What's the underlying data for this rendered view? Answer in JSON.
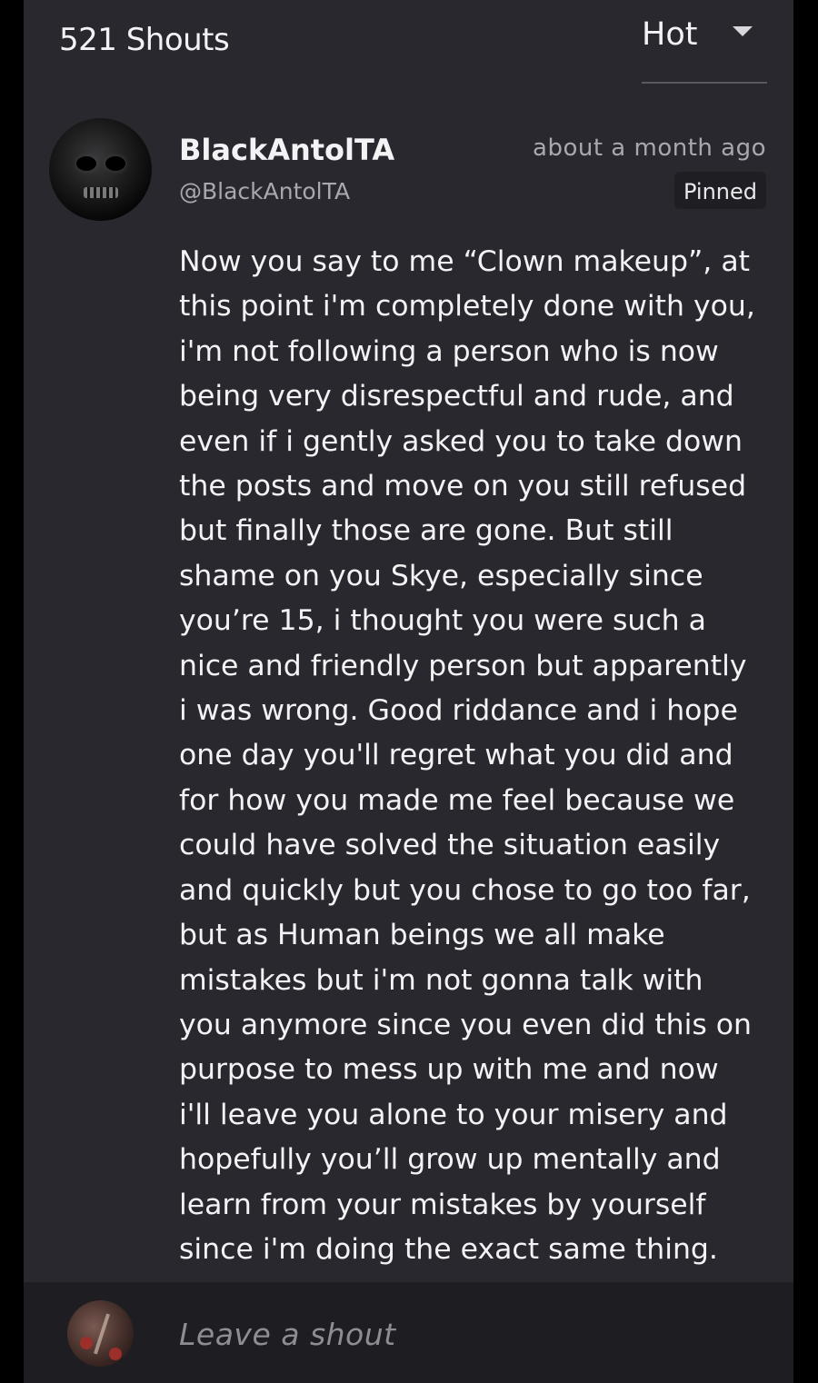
{
  "header": {
    "shout_count": "521 Shouts",
    "sort_label": "Hot",
    "sort_icon": "caret-down-icon"
  },
  "shout": {
    "author_name": "BlackAntolTA",
    "author_handle": "@BlackAntolTA",
    "timestamp": "about a month ago",
    "pinned_label": "Pinned",
    "avatar_icon": "skull-avatar",
    "lines": [
      "Now you say to me “Clown makeup”, at",
      "this point i'm completely done with you,",
      "i'm not following a person who is now",
      "being very disrespectful and rude, and",
      "even if i gently asked you to take down",
      "the posts and move on you still refused",
      "but finally those are gone. But still",
      "shame on you Skye, especially since",
      "you’re 15, i thought you were such a",
      "nice and friendly person but apparently",
      "i was wrong. Good riddance and i hope",
      "one day you'll regret what you did and",
      "for how you made me feel because we",
      "could have solved the situation easily",
      "and quickly but you chose to go too far,",
      "but as Human beings we all make",
      "mistakes but i'm not gonna talk with",
      "you anymore since you even did this on",
      "purpose to mess up with me and now",
      "i'll leave you alone to your misery and",
      "hopefully you’ll grow up mentally and",
      "learn from your mistakes by yourself",
      "since i'm doing the exact same thing."
    ]
  },
  "composer": {
    "placeholder": "Leave a shout"
  },
  "colors": {
    "background": "#29282e",
    "composer_background": "#1e1d22",
    "text_primary": "#f3f3f5",
    "text_secondary": "#a9a8ae"
  }
}
